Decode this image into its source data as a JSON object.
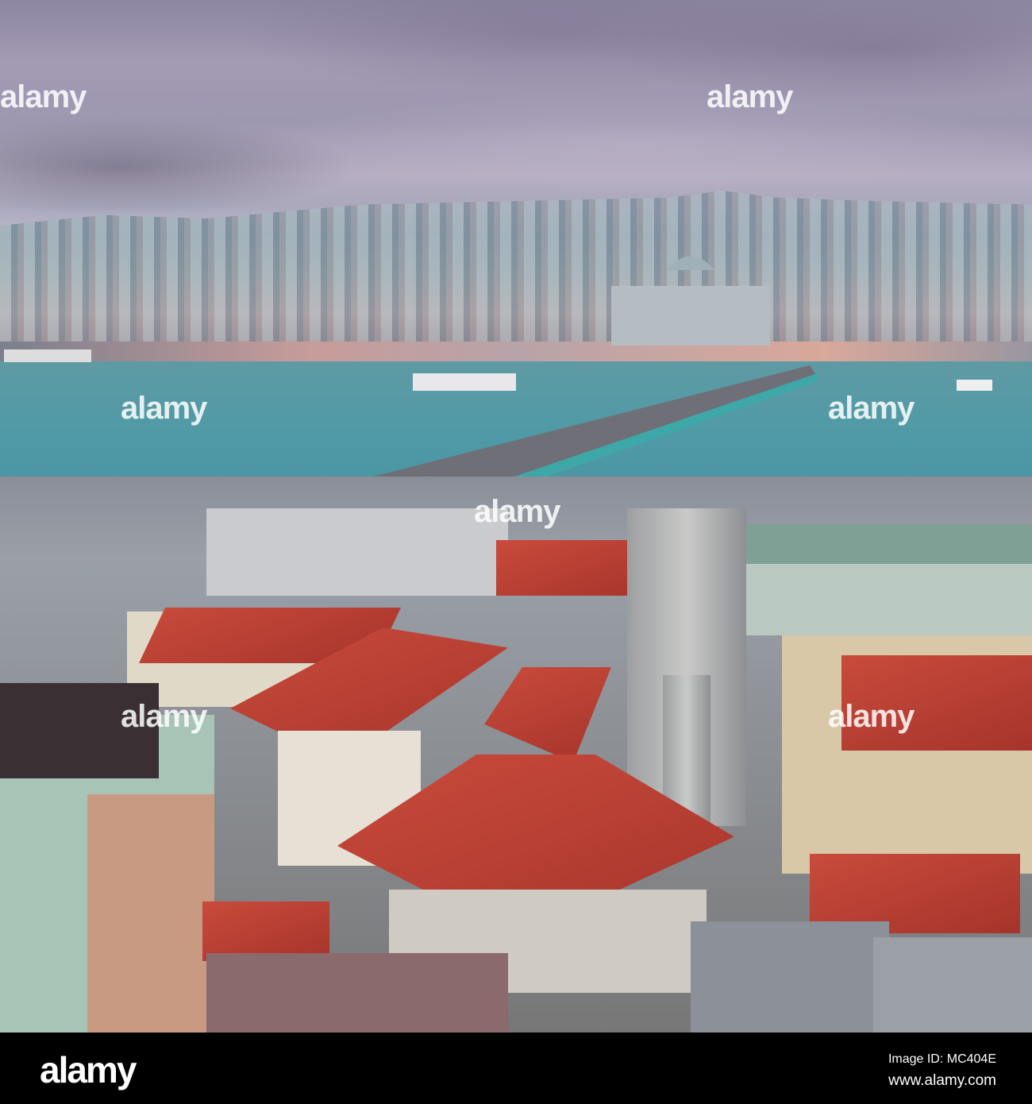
{
  "photo": {
    "subject": "Istanbul city view",
    "watermark_text": "alamy"
  },
  "footer": {
    "logo": "alamy",
    "image_id": "Image ID: MC404E",
    "url": "www.alamy.com"
  }
}
